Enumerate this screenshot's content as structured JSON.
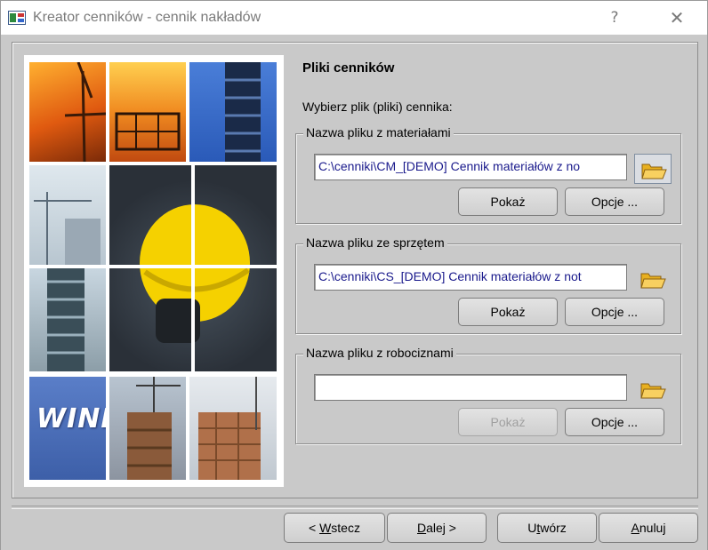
{
  "window": {
    "title": "Kreator cenników - cennik nakładów",
    "help_label": "?",
    "close_label": "✕"
  },
  "picture": {
    "logo_text": "WINBUD"
  },
  "page": {
    "heading": "Pliki cenników",
    "instruction": "Wybierz plik (pliki) cennika:"
  },
  "groups": [
    {
      "legend": "Nazwa pliku z materiałami",
      "path": "C:\\cenniki\\CM_[DEMO] Cennik materiałów z no",
      "show_label": "Pokaż",
      "options_label": "Opcje ...",
      "show_enabled": true,
      "icon": "folder-open-icon"
    },
    {
      "legend": "Nazwa pliku ze sprzętem",
      "path": "C:\\cenniki\\CS_[DEMO] Cennik materiałów z not",
      "show_label": "Pokaż",
      "options_label": "Opcje ...",
      "show_enabled": true,
      "icon": "folder-open-icon"
    },
    {
      "legend": "Nazwa pliku z robociznami",
      "path": "",
      "show_label": "Pokaż",
      "options_label": "Opcje ...",
      "show_enabled": false,
      "icon": "folder-open-icon"
    }
  ],
  "nav": {
    "back": {
      "prefix": "< ",
      "mnemonic": "W",
      "rest": "stecz"
    },
    "next": {
      "mnemonic": "D",
      "rest": "alej >"
    },
    "create": {
      "prefix": "U",
      "mnemonic": "t",
      "rest": "wórz"
    },
    "cancel": {
      "mnemonic": "A",
      "rest": "nuluj"
    }
  },
  "colors": {
    "path_text": "#1a1a8c",
    "window_bg": "#c9c9c9",
    "disabled_text": "#a0a0a0"
  }
}
